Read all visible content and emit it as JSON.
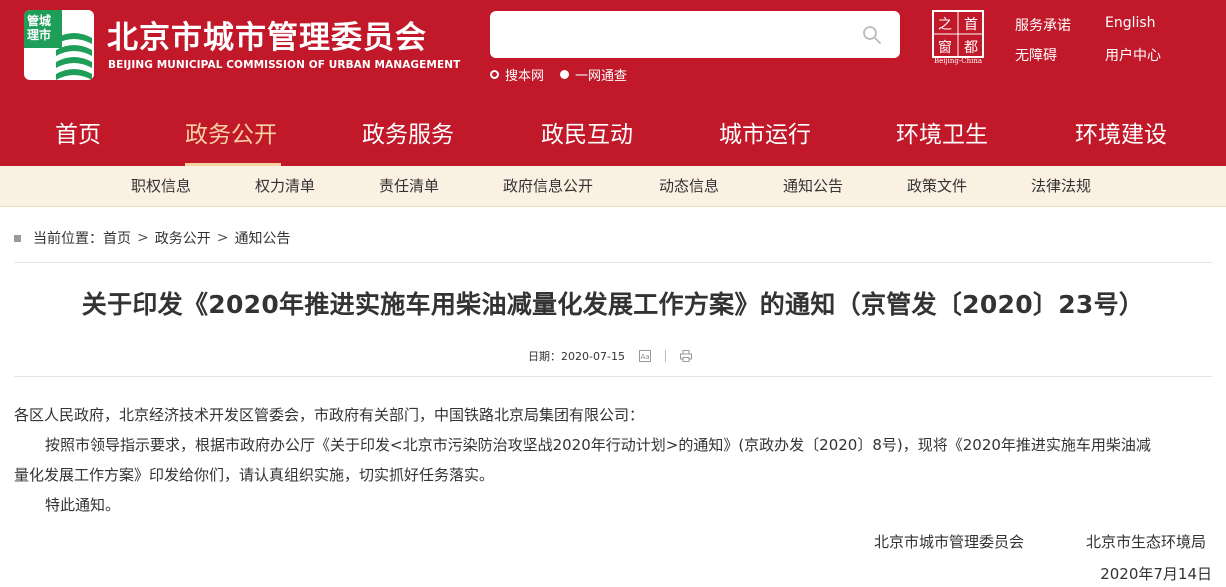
{
  "header": {
    "logo_text": "管城理市",
    "title_cn": "北京市城市管理委员会",
    "title_en": "BEIJING MUNICIPAL COMMISSION OF URBAN MANAGEMENT",
    "search_value": "",
    "search_options": [
      {
        "label": "搜本网",
        "selected": false
      },
      {
        "label": "一网通查",
        "selected": true
      }
    ],
    "stamp_text": "Beijing-China",
    "stamp_chars": [
      "之",
      "首",
      "窗",
      "都"
    ],
    "links": {
      "service_promise": "服务承诺",
      "english": "English",
      "accessibility": "无障碍",
      "user_center": "用户中心"
    }
  },
  "main_nav": {
    "items": [
      {
        "label": "首页"
      },
      {
        "label": "政务公开",
        "active": true
      },
      {
        "label": "政务服务"
      },
      {
        "label": "政民互动"
      },
      {
        "label": "城市运行"
      },
      {
        "label": "环境卫生"
      },
      {
        "label": "环境建设"
      }
    ]
  },
  "sub_nav": {
    "items": [
      "职权信息",
      "权力清单",
      "责任清单",
      "政府信息公开",
      "动态信息",
      "通知公告",
      "政策文件",
      "法律法规"
    ]
  },
  "breadcrumb": {
    "prefix": "当前位置：",
    "items": [
      "首页",
      "政务公开",
      "通知公告"
    ],
    "separator": ">"
  },
  "article": {
    "title": "关于印发《2020年推进实施车用柴油减量化发展工作方案》的通知（京管发〔2020〕23号）",
    "date_label": "日期：",
    "date": "2020-07-15",
    "salutation": "各区人民政府，北京经济技术开发区管委会，市政府有关部门，中国铁路北京局集团有限公司：",
    "para1_line1": "按照市领导指示要求，根据市政府办公厅《关于印发<北京市污染防治攻坚战2020年行动计划>的通知》(京政办发〔2020〕8号)，现将《2020年推进实施车用柴油减",
    "para1_line2": "量化发展工作方案》印发给你们，请认真组织实施，切实抓好任务落实。",
    "closing": "特此通知。",
    "signers": [
      "北京市城市管理委员会",
      "北京市生态环境局"
    ],
    "sign_date": "2020年7月14日"
  },
  "colors": {
    "brand_red": "#c1182a",
    "active_gold": "#f6d2a3",
    "subnav_bg": "#fbf1e3",
    "logo_green": "#1f9e5a"
  },
  "icons": [
    "search-icon",
    "font-size-icon",
    "print-icon"
  ]
}
